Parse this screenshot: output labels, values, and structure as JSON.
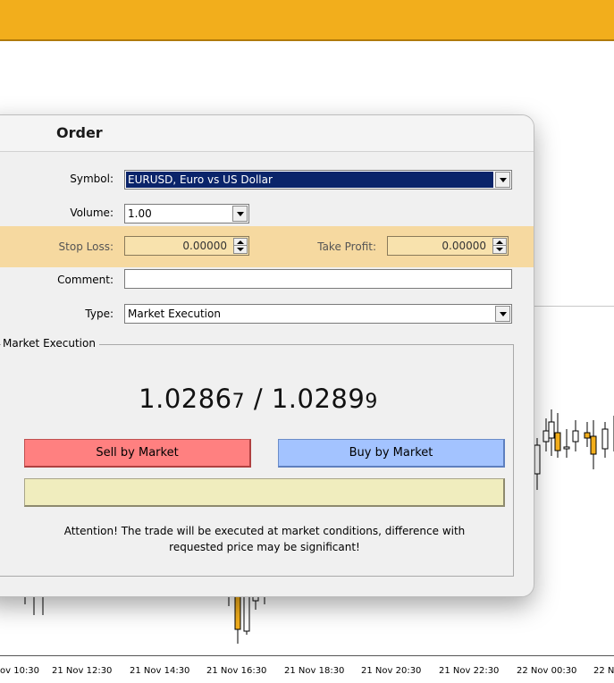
{
  "dialog": {
    "title": "Order",
    "symbol_label": "Symbol:",
    "symbol_value": "EURUSD, Euro vs US Dollar",
    "volume_label": "Volume:",
    "volume_value": "1.00",
    "stop_loss_label": "Stop Loss:",
    "stop_loss_value": "0.00000",
    "take_profit_label": "Take Profit:",
    "take_profit_value": "0.00000",
    "comment_label": "Comment:",
    "comment_value": "",
    "type_label": "Type:",
    "type_value": "Market Execution",
    "group_title": "Market Execution",
    "bid_main": "1.0286",
    "bid_small": "7",
    "separator": " / ",
    "ask_main": "1.0289",
    "ask_small": "9",
    "sell_label": "Sell by Market",
    "buy_label": "Buy by Market",
    "attention_line1": "Attention! The trade will be executed at market conditions, difference with",
    "attention_line2": "requested price may be significant!"
  },
  "colors": {
    "topbar": "#f2ae1c",
    "highlight": "#f6d9a0",
    "sell": "#ff8080",
    "buy": "#a3c3ff",
    "symbol_selected": "#0a246a"
  },
  "chart": {
    "time_axis": [
      "ov 10:30",
      "21 Nov 12:30",
      "21 Nov 14:30",
      "21 Nov 16:30",
      "21 Nov 18:30",
      "21 Nov 20:30",
      "21 Nov 22:30",
      "22 Nov 00:30",
      "22 N"
    ]
  }
}
